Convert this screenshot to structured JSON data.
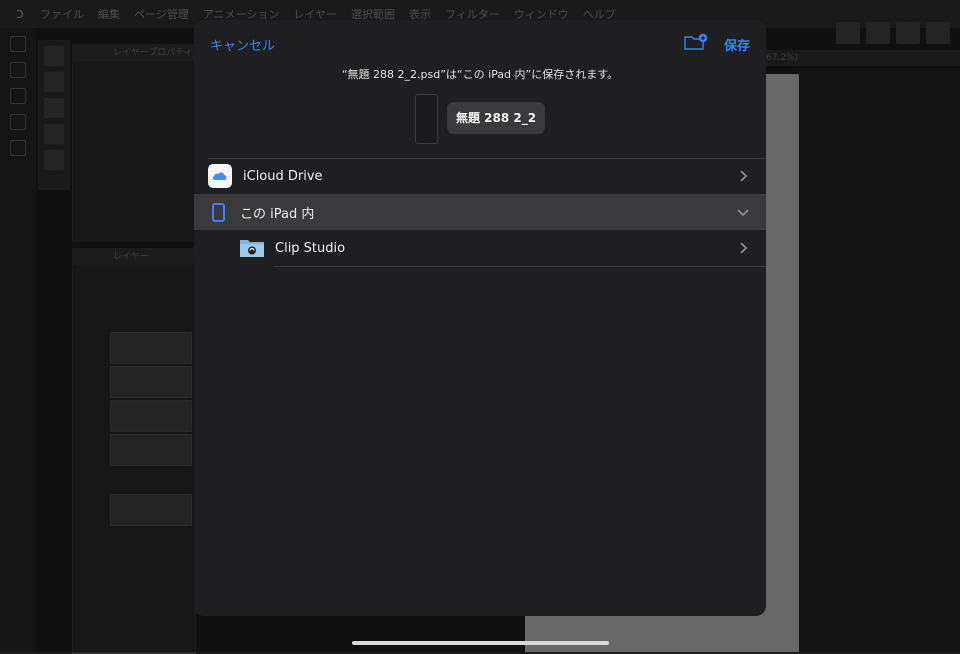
{
  "background": {
    "menu_items": [
      "ファイル",
      "編集",
      "ページ管理",
      "アニメーション",
      "レイヤー",
      "選択範囲",
      "表示",
      "フィルター",
      "ウィンドウ",
      "ヘルプ"
    ],
    "layer_property_title": "レイヤープロパティ",
    "layer_panel_title": "レイヤー",
    "zoom_text": "67.2%)"
  },
  "dialog": {
    "cancel_label": "キャンセル",
    "save_label": "保存",
    "message": "“無題 288 2_2.psd”は“この iPad 内”に保存されます。",
    "file_name": "無題 288 2_2",
    "locations": [
      {
        "label": "iCloud Drive",
        "icon": "icloud-icon"
      },
      {
        "label": "この iPad 内",
        "icon": "ipad-icon",
        "selected": true
      },
      {
        "label": "Clip Studio",
        "icon": "folder-icon"
      }
    ]
  },
  "colors": {
    "accent": "#3b82f6",
    "sheet_bg": "#1f1f21",
    "selected_row": "#3a3a3c"
  }
}
